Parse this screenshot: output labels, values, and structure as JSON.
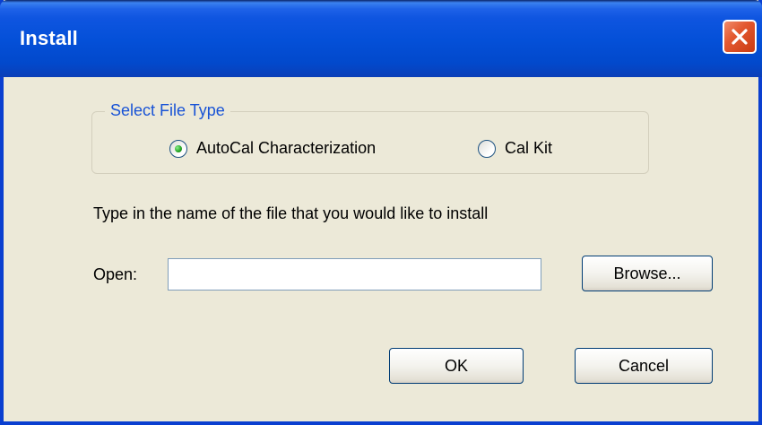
{
  "window": {
    "title": "Install"
  },
  "file_type_group": {
    "legend": "Select File Type",
    "options": [
      {
        "label": "AutoCal Characterization",
        "selected": true
      },
      {
        "label": "Cal Kit",
        "selected": false
      }
    ]
  },
  "instruction": "Type in the name of the file that you would like to install",
  "open_field": {
    "label": "Open:",
    "value": "",
    "browse_label": "Browse..."
  },
  "buttons": {
    "ok_label": "OK",
    "cancel_label": "Cancel"
  },
  "icons": {
    "close": "close-icon",
    "radio_selected": "radio-selected-icon",
    "radio_unselected": "radio-unselected-icon"
  },
  "colors": {
    "titlebar": "#0450d8",
    "window_bg": "#ece9d8",
    "group_legend": "#1853d6",
    "close_button": "#e3582f",
    "radio_dot": "#21a121"
  }
}
